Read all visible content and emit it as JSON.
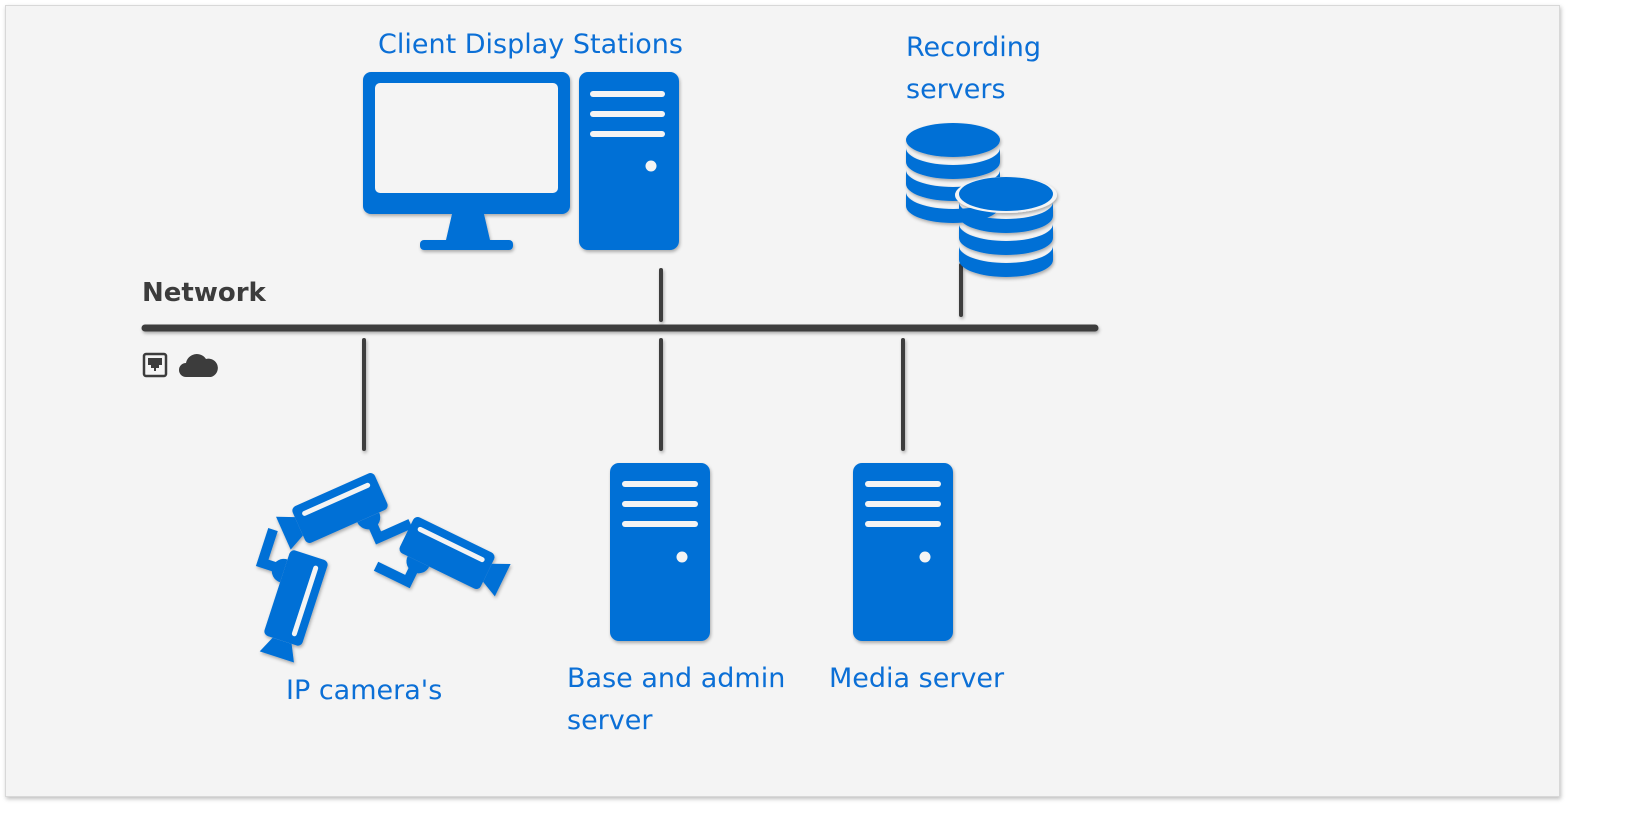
{
  "labels": {
    "client_stations": "Client Display Stations",
    "recording_servers": [
      "Recording",
      "servers"
    ],
    "network": "Network",
    "ip_cameras": "IP camera's",
    "base_admin": [
      "Base and admin",
      "server"
    ],
    "media_server": "Media server"
  },
  "icons": [
    "monitor-icon",
    "desktop-tower-icon",
    "database-icon",
    "ethernet-port-icon",
    "cloud-icon",
    "security-camera-icon",
    "server-icon"
  ],
  "colors": {
    "accent": "#0070d6",
    "line": "#3c3c3c",
    "background": "#f4f4f4"
  }
}
